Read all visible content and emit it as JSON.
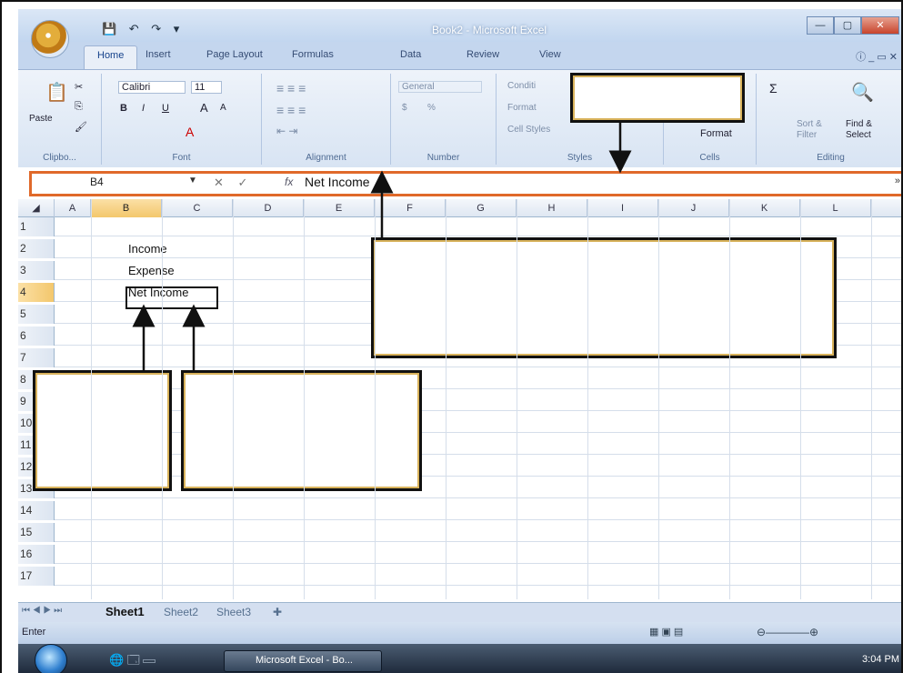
{
  "window": {
    "title": "Book2 - Microsoft Excel",
    "qat": "💾 ↶ ↷ ▾",
    "controls": [
      "—",
      "▢",
      "✕"
    ]
  },
  "tabs": [
    "Home",
    "Insert",
    "Page Layout",
    "Formulas",
    "Data",
    "Review",
    "View"
  ],
  "help": "ⓘ _ ▭ ✕",
  "ribbon": {
    "clipboard": {
      "paste": "Paste",
      "label": "Clipbo..."
    },
    "font": {
      "name": "Calibri",
      "size": "11",
      "bold": "B",
      "italic": "I",
      "underline": "U",
      "grow": "A",
      "shrink": "A",
      "color": "A",
      "label": "Font"
    },
    "alignment": {
      "label": "Alignment"
    },
    "number": {
      "format": "General",
      "currency": "$",
      "percent": "%",
      "label": "Number"
    },
    "styles": {
      "cond": "Conditi",
      "format": "Format",
      "cell": "Cell Styles",
      "label": "Styles"
    },
    "cells": {
      "format": "Format",
      "label": "Cells"
    },
    "editing": {
      "sum": "Σ",
      "sort": "Sort &",
      "filter": "Filter",
      "find": "Find &",
      "select": "Select",
      "label": "Editing"
    }
  },
  "formula_bar": {
    "name_box": "B4",
    "fx": "fx",
    "content": "Net Income",
    "buttons": "✕ ✓"
  },
  "columns": [
    "A",
    "B",
    "C",
    "D",
    "E",
    "F",
    "G",
    "H",
    "I",
    "J",
    "K",
    "L"
  ],
  "selected_column": "B",
  "rows": [
    {
      "n": "1",
      "b": ""
    },
    {
      "n": "2",
      "b": "Income"
    },
    {
      "n": "3",
      "b": "Expense"
    },
    {
      "n": "4",
      "b": "Net Income"
    },
    {
      "n": "5",
      "b": ""
    },
    {
      "n": "6",
      "b": ""
    },
    {
      "n": "7",
      "b": ""
    },
    {
      "n": "8",
      "b": ""
    },
    {
      "n": "9",
      "b": ""
    },
    {
      "n": "10",
      "b": ""
    },
    {
      "n": "11",
      "b": ""
    },
    {
      "n": "12",
      "b": ""
    },
    {
      "n": "13",
      "b": ""
    },
    {
      "n": "14",
      "b": ""
    },
    {
      "n": "15",
      "b": ""
    },
    {
      "n": "16",
      "b": ""
    },
    {
      "n": "17",
      "b": ""
    }
  ],
  "active_row": "4",
  "sheets": [
    "Sheet1",
    "Sheet2",
    "Sheet3"
  ],
  "status": {
    "mode": "Enter"
  },
  "taskbar": {
    "app": "Microsoft Excel - Bo...",
    "time": "3:04 PM"
  }
}
